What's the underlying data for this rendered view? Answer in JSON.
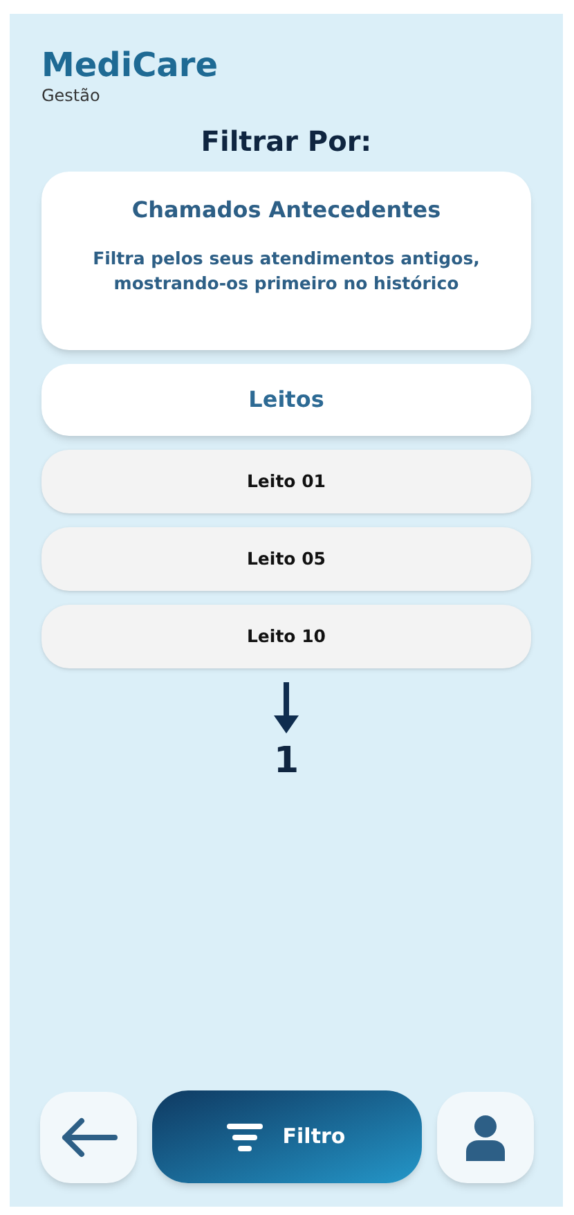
{
  "header": {
    "title": "MediCare",
    "subtitle": "Gestão"
  },
  "heading": "Filtrar Por:",
  "filter_card": {
    "title": "Chamados Antecedentes",
    "description": "Filtra pelos seus atendimentos antigos, mostrando-os primeiro no histórico"
  },
  "beds_header": "Leitos",
  "beds": [
    {
      "label": "Leito 01"
    },
    {
      "label": "Leito 05"
    },
    {
      "label": "Leito 10"
    }
  ],
  "page_indicator": "1",
  "bottom_nav": {
    "filter_label": "Filtro"
  }
}
